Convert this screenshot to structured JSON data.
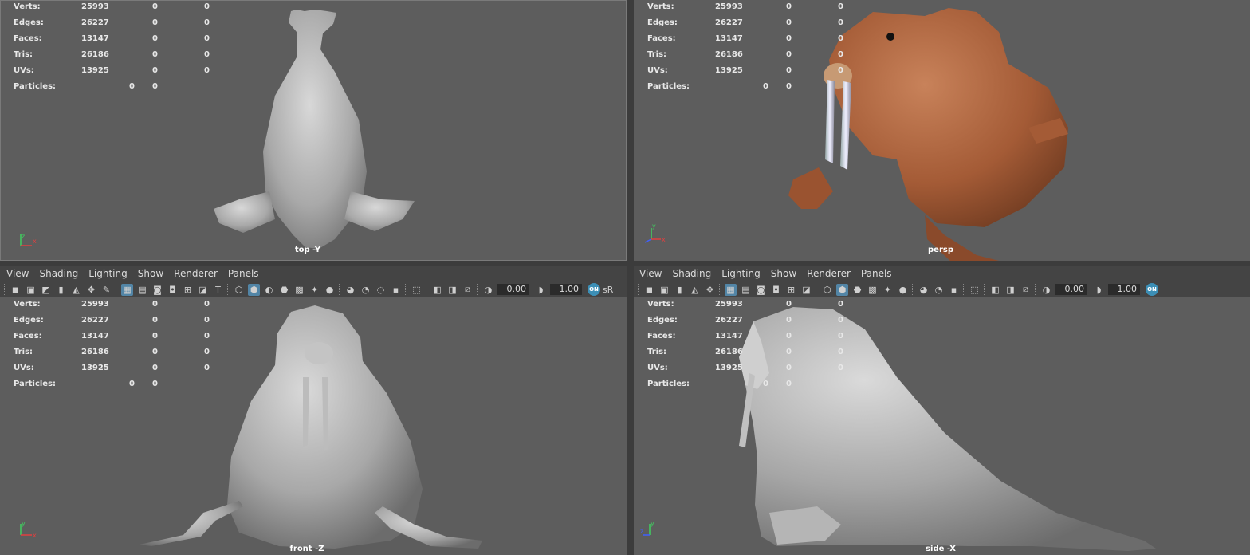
{
  "stats": {
    "rows": [
      {
        "label": "Verts:",
        "v1": "25993",
        "v2": "0",
        "v3": "0"
      },
      {
        "label": "Edges:",
        "v1": "26227",
        "v2": "0",
        "v3": "0"
      },
      {
        "label": "Faces:",
        "v1": "13147",
        "v2": "0",
        "v3": "0"
      },
      {
        "label": "Tris:",
        "v1": "26186",
        "v2": "0",
        "v3": "0"
      },
      {
        "label": "UVs:",
        "v1": "13925",
        "v2": "0",
        "v3": "0"
      }
    ],
    "particles": {
      "label": "Particles:",
      "v1": "0",
      "v2": "0"
    }
  },
  "viewports": {
    "top": {
      "camera": "top -Y"
    },
    "persp": {
      "camera": "persp"
    },
    "front": {
      "camera": "front -Z"
    },
    "side": {
      "camera": "side -X"
    }
  },
  "axis": {
    "x_label": "x",
    "y_label": "y",
    "z_label": "z",
    "x_color": "#e04040",
    "y_color": "#40d060",
    "z_color": "#4060ff"
  },
  "menu": {
    "items": [
      "View",
      "Shading",
      "Lighting",
      "Show",
      "Renderer",
      "Panels"
    ]
  },
  "toolbar": {
    "exposure": "0.00",
    "gamma": "1.00",
    "badge": "ON",
    "color_space": "sR",
    "icons": [
      "camera-icon",
      "camera-attributes-icon",
      "bookmark-icon",
      "image-plane-icon",
      "grid-icon",
      "film-gate-icon",
      "resolution-gate-icon",
      "safe-action-icon",
      "wireframe-icon",
      "smooth-shade-icon",
      "default-material-icon",
      "textured-icon",
      "lights-icon",
      "shadows-icon",
      "ambient-occlusion-icon",
      "isolate-select-icon",
      "xray-icon",
      "backface-icon",
      "exposure-icon",
      "gamma-icon"
    ]
  }
}
